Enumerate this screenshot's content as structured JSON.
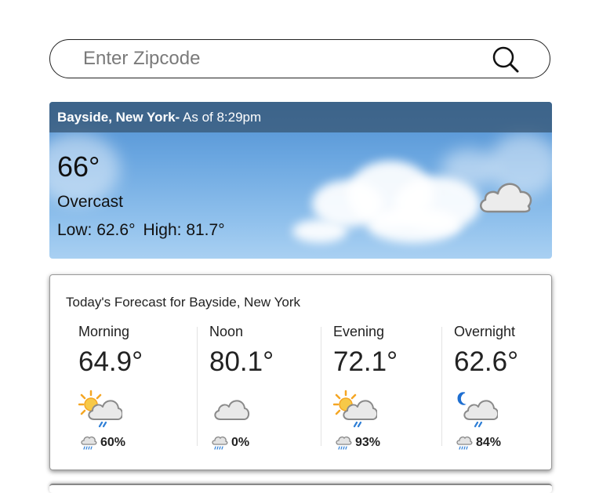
{
  "search": {
    "placeholder": "Enter Zipcode",
    "value": "",
    "icon": "search-icon"
  },
  "current": {
    "location": "Bayside, New York-",
    "as_of": " As of 8:29pm",
    "temperature": "66°",
    "condition": "Overcast",
    "low": "Low: 62.6°",
    "high": "High: 81.7°",
    "icon": "cloud-icon"
  },
  "forecast": {
    "title": "Today's Forecast for Bayside, New York",
    "periods": [
      {
        "label": "Morning",
        "temp": "64.9°",
        "icon": "partly-sunny-rain-icon",
        "precip": "60%"
      },
      {
        "label": "Noon",
        "temp": "80.1°",
        "icon": "cloud-icon",
        "precip": "0%"
      },
      {
        "label": "Evening",
        "temp": "72.1°",
        "icon": "partly-sunny-rain-icon",
        "precip": "93%"
      },
      {
        "label": "Overnight",
        "temp": "62.6°",
        "icon": "night-rain-icon",
        "precip": "84%"
      }
    ]
  },
  "colors": {
    "sun": "#f5a623",
    "rain": "#2f7fd6",
    "moon": "#1f6fd1",
    "cloud_fill": "#e9e9e9",
    "cloud_stroke": "#8a8a8a"
  }
}
